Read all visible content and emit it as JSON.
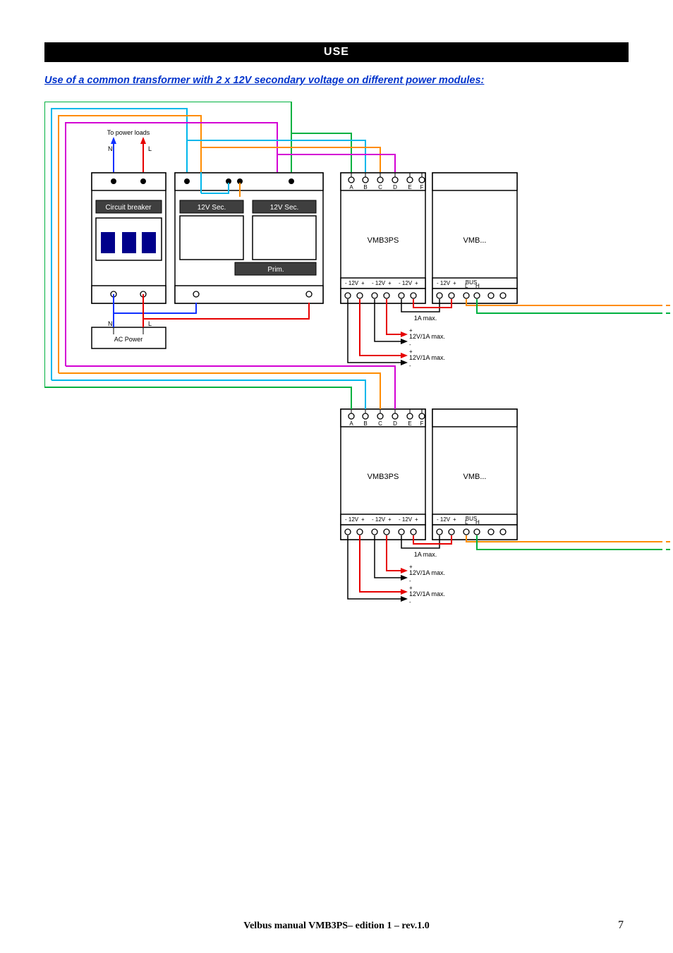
{
  "header": {
    "title": "USE"
  },
  "section_title": "Use of a common transformer with 2 x 12V secondary voltage on different power modules:",
  "diagram": {
    "top_label": "To power loads",
    "n_label": "N",
    "l_label": "L",
    "ac_power": "AC Power",
    "circuit_breaker": "Circuit breaker",
    "sec_label": "12V Sec.",
    "prim_label": "Prim.",
    "module_ps": "VMB3PS",
    "module_other": "VMB...",
    "top_term_labels": [
      "A",
      "B",
      "C",
      "D",
      "E",
      "F"
    ],
    "bottom_12v": "12V",
    "bus_label": "BUS",
    "bus_l": "L",
    "bus_h": "H",
    "out_1a": "1A max.",
    "out_12v": "12V/1A max."
  },
  "footer": "Velbus manual VMB3PS– edition 1 – rev.1.0",
  "page_number": "7"
}
